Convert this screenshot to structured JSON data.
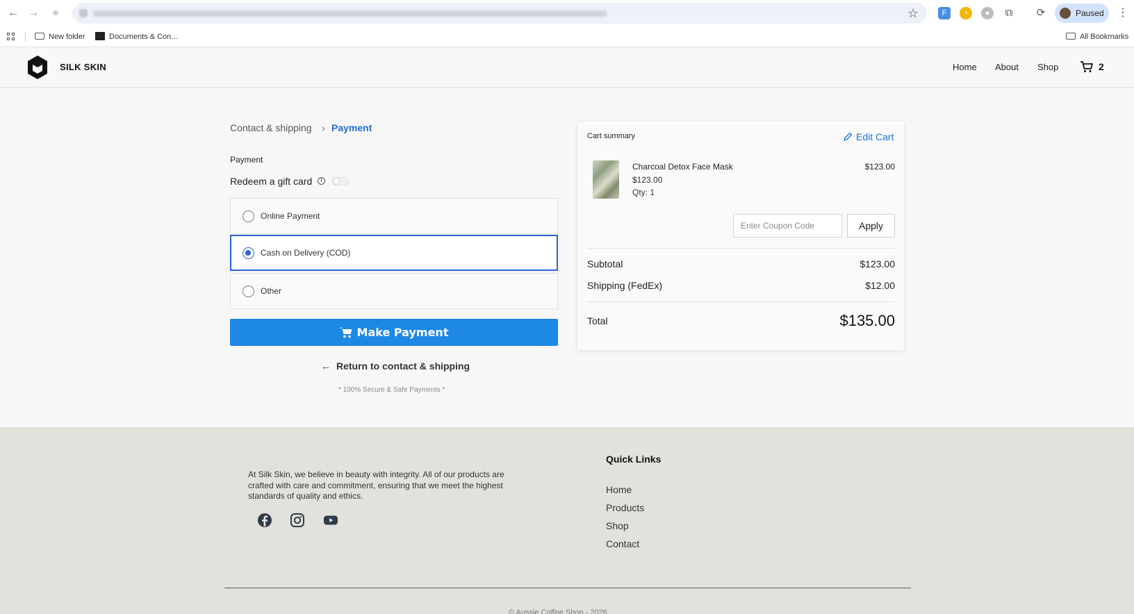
{
  "browser": {
    "bookmarks": [
      {
        "label": "New folder",
        "icon": "folder-icon"
      },
      {
        "label": "Documents & Con...",
        "icon": "document-icon"
      }
    ],
    "all_bookmarks_label": "All Bookmarks",
    "profile_label": "Paused"
  },
  "header": {
    "brand": "SILK SKIN",
    "nav": [
      "Home",
      "About",
      "Shop"
    ],
    "cart_count": "2"
  },
  "checkout": {
    "breadcrumb": [
      "Contact & shipping",
      "Payment"
    ],
    "breadcrumb_separator": "›",
    "section_label": "Payment",
    "gift_card_label": "Redeem a gift card",
    "gift_card_enabled": false,
    "payment_options": [
      {
        "label": "Online Payment",
        "selected": false
      },
      {
        "label": "Cash on Delivery (COD)",
        "selected": true
      },
      {
        "label": "Other",
        "selected": false
      }
    ],
    "make_payment_label": "Make Payment",
    "return_label": "Return to contact & shipping",
    "secure_note": "* 100% Secure & Safe Payments *"
  },
  "cart_summary": {
    "title": "Cart summary",
    "edit_label": "Edit Cart",
    "item": {
      "name": "Charcoal Detox Face Mask",
      "price": "$123.00",
      "qty": "Qty: 1",
      "line_total": "$123.00"
    },
    "coupon_placeholder": "Enter Coupon Code",
    "apply_label": "Apply",
    "subtotal_label": "Subtotal",
    "subtotal_value": "$123.00",
    "shipping_label": "Shipping (FedEx)",
    "shipping_value": "$12.00",
    "total_label": "Total",
    "total_value": "$135.00"
  },
  "footer": {
    "about": "At Silk Skin, we believe in beauty with integrity. All of our products are crafted with care and commitment, ensuring that we meet the highest standards of quality and ethics.",
    "social": [
      "facebook-icon",
      "instagram-icon",
      "youtube-icon"
    ],
    "quick_links_title": "Quick Links",
    "quick_links": [
      "Home",
      "Products",
      "Shop",
      "Contact"
    ],
    "copyright": "© Aussie Coffee Shop - 2026"
  },
  "colors": {
    "accent": "#1e88e5",
    "link": "#1f6fd1",
    "selected_border": "#2b63d8",
    "footer_bg": "#e3e1dc"
  }
}
